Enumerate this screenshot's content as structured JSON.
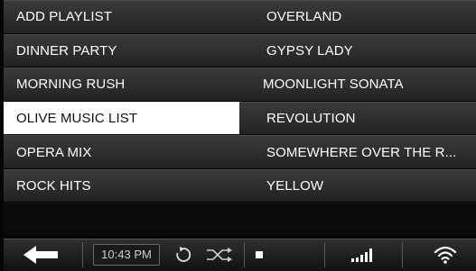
{
  "playlists": [
    {
      "label": "ADD PLAYLIST"
    },
    {
      "label": "DINNER PARTY"
    },
    {
      "label": "MORNING RUSH"
    },
    {
      "label": "OLIVE MUSIC LIST",
      "selected": true
    },
    {
      "label": "OPERA MIX"
    },
    {
      "label": "ROCK HITS"
    }
  ],
  "songs": [
    {
      "label": "OVERLAND"
    },
    {
      "label": "GYPSY LADY"
    },
    {
      "label": "MOONLIGHT SONATA"
    },
    {
      "label": "REVOLUTION"
    },
    {
      "label": "SOMEWHERE OVER THE R..."
    },
    {
      "label": "YELLOW"
    }
  ],
  "toolbar": {
    "time": "10:43 PM",
    "icons": [
      "back-arrow-icon",
      "repeat-icon",
      "shuffle-icon",
      "stop-icon",
      "signal-strength-icon",
      "wifi-icon"
    ]
  },
  "colors": {
    "row_bg": "#2d2d2d",
    "selected_bg": "#ffffff",
    "selected_text": "#111111",
    "text": "#ffffff"
  }
}
